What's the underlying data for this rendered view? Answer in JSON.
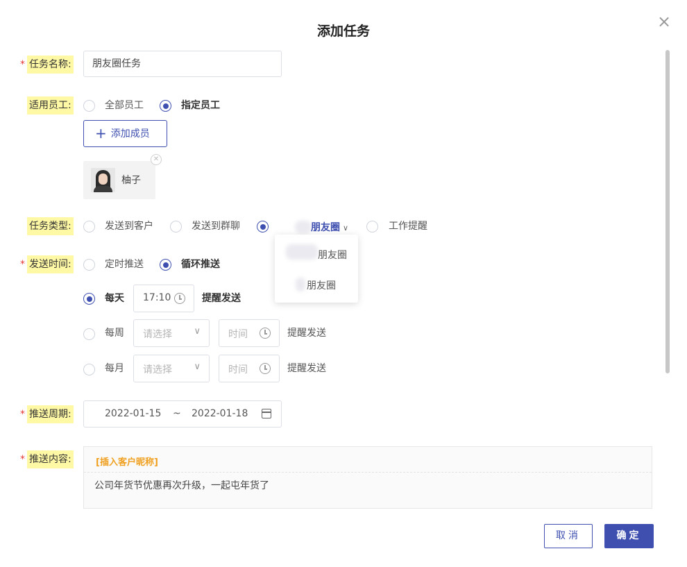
{
  "dialog": {
    "title": "添加任务",
    "close_symbol": "×"
  },
  "task_name": {
    "label": "任务名称:",
    "required": "*",
    "value": "朋友圈任务"
  },
  "staff": {
    "label": "适用员工:",
    "options": [
      {
        "label": "全部员工",
        "checked": false
      },
      {
        "label": "指定员工",
        "checked": true
      }
    ],
    "add_button_label": "添加成员",
    "members": [
      {
        "name": "柚子"
      }
    ]
  },
  "task_type": {
    "label": "任务类型:",
    "options": [
      {
        "label": "发送到客户",
        "checked": false
      },
      {
        "label": "发送到群聊",
        "checked": false
      },
      {
        "label": "朋友圈",
        "checked": true
      },
      {
        "label": "工作提醒",
        "checked": false
      }
    ],
    "dropdown_items": [
      "朋友圈",
      "朋友圈"
    ]
  },
  "send_time": {
    "label": "发送时间:",
    "required": "*",
    "options": [
      {
        "label": "定时推送",
        "checked": false
      },
      {
        "label": "循环推送",
        "checked": true
      }
    ],
    "schedules": [
      {
        "label": "每天",
        "checked": true,
        "time": "17:10",
        "suffix": "提醒发送"
      },
      {
        "label": "每周",
        "checked": false,
        "select_placeholder": "请选择",
        "time_placeholder": "时间",
        "suffix": "提醒发送"
      },
      {
        "label": "每月",
        "checked": false,
        "select_placeholder": "请选择",
        "time_placeholder": "时间",
        "suffix": "提醒发送"
      }
    ]
  },
  "period": {
    "label": "推送周期:",
    "required": "*",
    "start": "2022-01-15",
    "separator": "~",
    "end": "2022-01-18"
  },
  "content": {
    "label": "推送内容:",
    "required": "*",
    "insert_tag": "[插入客户昵称]",
    "text": "公司年货节优惠再次升级，一起屯年货了"
  },
  "footer": {
    "cancel_label": "取消",
    "ok_label": "确定"
  },
  "colors": {
    "accent": "#3e4fb0",
    "label_highlight": "#fff9a6",
    "required": "#e53935",
    "insert_tag": "#f0a020"
  }
}
